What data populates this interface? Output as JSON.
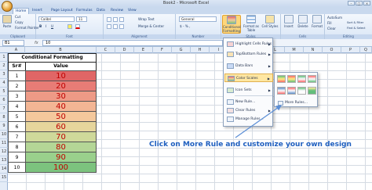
{
  "window": {
    "title": "Book2 - Microsoft Excel"
  },
  "tabs": [
    "Home",
    "Insert",
    "Page Layout",
    "Formulas",
    "Data",
    "Review",
    "View"
  ],
  "ribbon": {
    "clipboard": {
      "label": "Clipboard",
      "paste": "Paste",
      "cut": "Cut",
      "copy": "Copy",
      "format_painter": "Format Painter"
    },
    "font": {
      "label": "Font",
      "name": "Calibri",
      "size": "11"
    },
    "alignment": {
      "label": "Alignment",
      "wrap": "Wrap Text",
      "merge": "Merge & Center"
    },
    "number": {
      "label": "Number",
      "format": "General",
      "symbols": "$ - % ,"
    },
    "styles": {
      "label": "Styles",
      "conditional": "Conditional Formatting",
      "format_table": "Format as Table",
      "cell_styles": "Cell Styles"
    },
    "cells": {
      "label": "Cells",
      "insert": "Insert",
      "delete": "Delete",
      "format": "Format"
    },
    "editing": {
      "label": "Editing",
      "autosum": "AutoSum",
      "fill": "Fill",
      "clear": "Clear",
      "sort": "Sort & Filter",
      "find": "Find & Select"
    }
  },
  "formula_bar": {
    "name_box": "B1",
    "fx": "fx",
    "value": "10"
  },
  "columns": [
    "A",
    "B",
    "C",
    "D",
    "E",
    "F",
    "G",
    "H",
    "I",
    "J",
    "K",
    "L",
    "M",
    "N",
    "O",
    "P",
    "Q",
    "R"
  ],
  "rows": [
    "1",
    "2",
    "3",
    "4",
    "5",
    "6",
    "7",
    "8",
    "9",
    "10",
    "11",
    "12",
    "13",
    "14",
    "15"
  ],
  "table": {
    "title": "Conditional Formatting",
    "header_sr": "Sr#",
    "header_value": "Value",
    "rows": [
      {
        "sr": "1",
        "value": "10",
        "color": "#e06666"
      },
      {
        "sr": "2",
        "value": "20",
        "color": "#e87c76"
      },
      {
        "sr": "3",
        "value": "30",
        "color": "#ee9a86"
      },
      {
        "sr": "4",
        "value": "40",
        "color": "#f3b594"
      },
      {
        "sr": "5",
        "value": "50",
        "color": "#f4c89c"
      },
      {
        "sr": "6",
        "value": "60",
        "color": "#e6d59c"
      },
      {
        "sr": "7",
        "value": "70",
        "color": "#cfd99a"
      },
      {
        "sr": "8",
        "value": "80",
        "color": "#b4d696"
      },
      {
        "sr": "9",
        "value": "90",
        "color": "#9ad08c"
      },
      {
        "sr": "10",
        "value": "100",
        "color": "#7cc37e"
      }
    ]
  },
  "menu": {
    "items": [
      {
        "label": "Highlight Cells Rules",
        "has_sub": true
      },
      {
        "label": "Top/Bottom Rules",
        "has_sub": true
      },
      {
        "label": "Data Bars",
        "has_sub": true
      },
      {
        "label": "Color Scales",
        "has_sub": true,
        "active": true
      },
      {
        "label": "Icon Sets",
        "has_sub": true
      },
      {
        "label": "New Rule...",
        "has_sub": false
      },
      {
        "label": "Clear Rules",
        "has_sub": true
      },
      {
        "label": "Manage Rules...",
        "has_sub": false
      }
    ],
    "more_rules": "More Rules..."
  },
  "caption": "Click on More Rule and customize  your own design"
}
